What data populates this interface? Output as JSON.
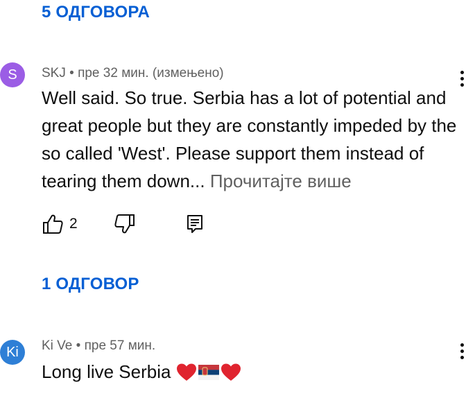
{
  "replies_top": {
    "label": "5 ОДГОВОРА"
  },
  "comments": [
    {
      "avatar_letter": "S",
      "avatar_color": "#9b5de5",
      "author": "SKJ",
      "time": "пре 32 мин.",
      "edited": "(измењено)",
      "text": "Well said.  So true.  Serbia has a lot of potential and great people but they are constantly impeded by the so called 'West'.  Please support them instead of tearing them down...",
      "read_more": "Прочитајте више",
      "likes": "2",
      "icons": [
        "thumbs-up-icon",
        "thumbs-down-icon",
        "reply-icon",
        "more-vert-icon"
      ]
    },
    {
      "avatar_letter": "Ki",
      "avatar_color": "#2e7fd6",
      "author": "Ki Ve",
      "time": "пре 57 мин.",
      "text": "Long live Serbia",
      "emoji": [
        "red-heart-icon",
        "serbian-flag-icon",
        "red-heart-icon"
      ],
      "icons": [
        "more-vert-icon"
      ]
    }
  ],
  "replies_mid": {
    "label": "1 ОДГОВОР"
  },
  "separator": "•",
  "colors": {
    "link_blue": "#065fd4",
    "meta_gray": "#606060",
    "text": "#0f0f0f"
  }
}
